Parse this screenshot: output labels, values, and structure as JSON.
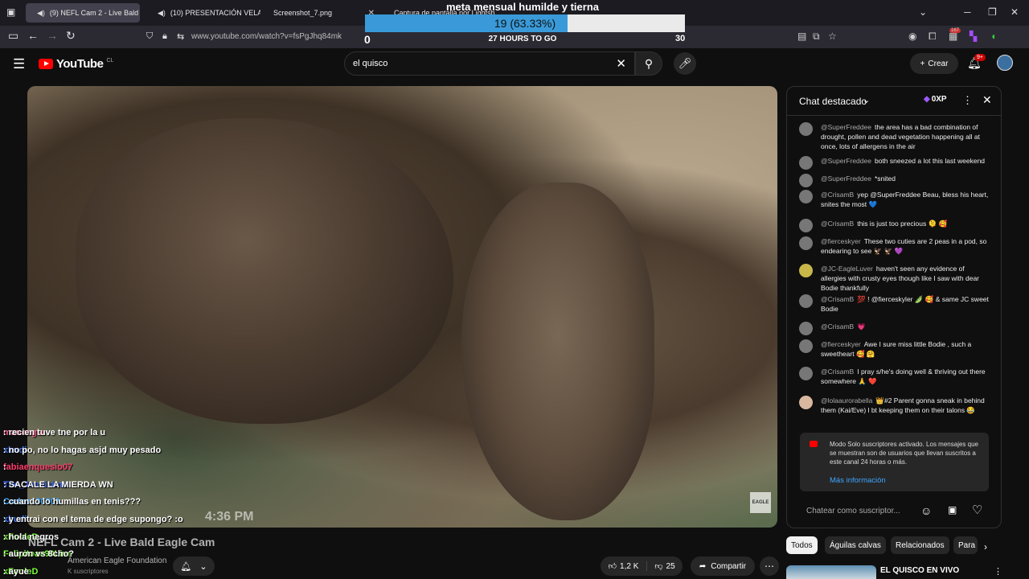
{
  "browser": {
    "tabs": [
      {
        "label": "(9) NEFL Cam 2 - Live Bald E"
      },
      {
        "label": "(10) PRESENTACIÓN VELAD"
      },
      {
        "label": "Screenshot_7.png"
      },
      {
        "label": "Captura de pantalla por Lightsh"
      }
    ],
    "url": "www.youtube.com/watch?v=fsPgJhq84mk",
    "ext_badge": "167"
  },
  "goal": {
    "title": "meta mensual humilde y tierna",
    "progress_text": "19 (63.33%)",
    "progress_fraction": 0.6333,
    "min": "0",
    "max": "30",
    "time_left": "27 HOURS TO GO"
  },
  "header": {
    "logo_text": "YouTube",
    "country": "CL",
    "search_value": "el quisco",
    "create_label": "Crear",
    "bell_badge": "9+"
  },
  "video": {
    "watermark": "EAGLE",
    "timestamp": "4:36 PM",
    "title": "NEFL Cam 2 - Live Bald Eagle Cam",
    "channel": "American Eagle Foundation",
    "subscribers": "K suscriptores",
    "likes": "1,2 K",
    "dislikes": "25",
    "share_label": "Compartir"
  },
  "overlay_chat": [
    {
      "user": "mancagia",
      "text": ": recien tuve tne por la u"
    },
    {
      "user": "xbudi",
      "text": ": no po, no lo hagas asjd muy pesado"
    },
    {
      "user": "fabiaenquesio07",
      "text": ":"
    },
    {
      "user": "The_Juanisimo",
      "text": ": SACALE LA MIERDA WN"
    },
    {
      "user": "Carlos130901",
      "text": ": cuando lo humillas en tenis???"
    },
    {
      "user": "xbudi",
      "text": ": y entrai con el tema de edge supongo? :o"
    },
    {
      "user": "xFooleD",
      "text": ": hola negros"
    },
    {
      "user": "Felipitoae90Live",
      "text": ": auron vs 8cho?"
    },
    {
      "user": "xFooleD",
      "text": ": ayue"
    }
  ],
  "chat": {
    "title": "Chat destacado",
    "xp": "0XP",
    "messages": [
      {
        "author": "@SuperFreddee",
        "text": "the area has a bad combination of drought, pollen and dead vegetation happening all at once, lots of allergens in the air"
      },
      {
        "author": "@SuperFreddee",
        "text": "both sneezed a lot this last weekend"
      },
      {
        "author": "@SuperFreddee",
        "text": "*snited"
      },
      {
        "author": "@CrisamB",
        "text": "yep @SuperFreddee Beau, bless his heart, snites the most 💙"
      },
      {
        "author": "@CrisamB",
        "text": "this is just too precious 🫠 🥰"
      },
      {
        "author": "@fierceskyer",
        "text": "These two cuties are 2 peas in a pod, so endearing to see 🦅 🦅 💜"
      },
      {
        "author": "@JC-EagleLuver",
        "text": "haven't seen any evidence of allergies with crusty eyes though like I saw with dear Bodie thankfully"
      },
      {
        "author": "@CrisamB",
        "text": "💯 ! @fierceskyler 🫛 🥰 & same JC sweet Bodie"
      },
      {
        "author": "@CrisamB",
        "text": "💗"
      },
      {
        "author": "@fierceskyer",
        "text": "Awe I sure miss little Bodie , such a sweetheart 🥰 🤗"
      },
      {
        "author": "@CrisamB",
        "text": "I pray s/he's doing well & thriving out there somewhere 🙏 ❤️"
      },
      {
        "author": "@lolaaurorabella",
        "text": "👑#2 Parent gonna sneak in behind them (Kai/Eve) l bt keeping them on their talons 😂"
      }
    ],
    "notice_text": "Modo Solo suscriptores activado. Los mensajes que se muestran son de usuarios que llevan suscritos a este canal 24 horas o más.",
    "notice_link": "Más información",
    "input_placeholder": "Chatear como suscriptor..."
  },
  "chips": [
    "Todos",
    "Águilas calvas",
    "Relacionados",
    "Para"
  ],
  "related": {
    "title": "EL QUISCO EN VIVO"
  }
}
